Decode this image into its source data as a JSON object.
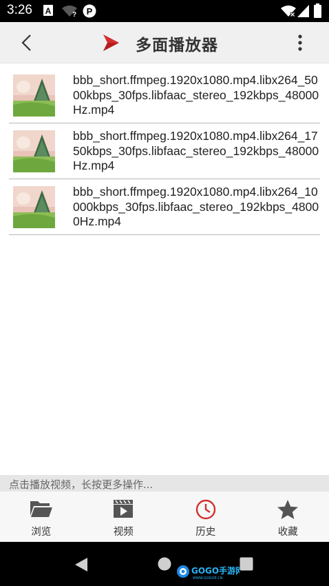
{
  "status_bar": {
    "time": "3:26",
    "icons": [
      "a-notification-icon",
      "wifi-unknown-icon",
      "p-notification-icon",
      "wifi-x-icon",
      "signal-icon",
      "battery-icon"
    ]
  },
  "app_bar": {
    "title": "多面播放器",
    "back_icon": "chevron-left-icon",
    "logo_icon": "play-logo-icon",
    "more_icon": "more-vert-icon"
  },
  "files": [
    {
      "name": "bbb_short.ffmpeg.1920x1080.mp4.libx264_5000kbps_30fps.libfaac_stereo_192kbps_48000Hz.mp4",
      "thumbnail": "video-thumbnail"
    },
    {
      "name": "bbb_short.ffmpeg.1920x1080.mp4.libx264_1750kbps_30fps.libfaac_stereo_192kbps_48000Hz.mp4",
      "thumbnail": "video-thumbnail"
    },
    {
      "name": "bbb_short.ffmpeg.1920x1080.mp4.libx264_10000kbps_30fps.libfaac_stereo_192kbps_48000Hz.mp4",
      "thumbnail": "video-thumbnail"
    }
  ],
  "hint": "点击播放视频，长按更多操作...",
  "bottom_nav": {
    "items": [
      {
        "label": "浏览",
        "icon": "folder-open-icon"
      },
      {
        "label": "视频",
        "icon": "video-play-icon"
      },
      {
        "label": "历史",
        "icon": "clock-icon",
        "active": true
      },
      {
        "label": "收藏",
        "icon": "star-icon"
      }
    ]
  },
  "system_nav": {
    "icons": [
      "back-triangle-icon",
      "home-circle-icon",
      "recents-square-icon"
    ]
  },
  "watermark": {
    "text": "GOGO手游网",
    "sub": "WWW.GOGOE.CN"
  },
  "colors": {
    "accent_red": "#d32f2f",
    "nav_icon": "#555555",
    "title": "#333333"
  }
}
